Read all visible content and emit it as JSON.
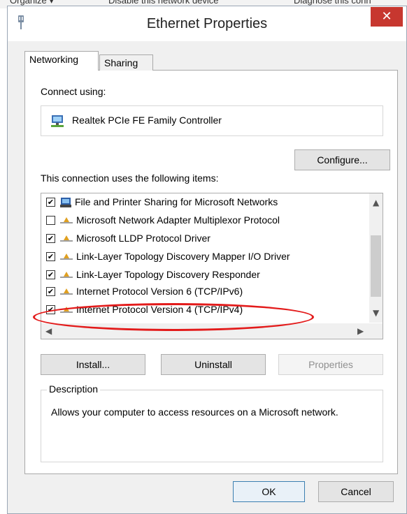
{
  "window": {
    "title": "Ethernet Properties"
  },
  "tabs": [
    "Networking",
    "Sharing"
  ],
  "connect_using_label": "Connect using:",
  "adapter_name": "Realtek PCIe FE Family Controller",
  "configure_button": "Configure...",
  "items_label": "This connection uses the following items:",
  "items": [
    {
      "label": "File and Printer Sharing for Microsoft Networks",
      "checked": true,
      "icon": "printer-share-icon"
    },
    {
      "label": "Microsoft Network Adapter Multiplexor Protocol",
      "checked": false,
      "icon": "network-protocol-icon"
    },
    {
      "label": "Microsoft LLDP Protocol Driver",
      "checked": true,
      "icon": "network-protocol-icon"
    },
    {
      "label": "Link-Layer Topology Discovery Mapper I/O Driver",
      "checked": true,
      "icon": "network-protocol-icon"
    },
    {
      "label": "Link-Layer Topology Discovery Responder",
      "checked": true,
      "icon": "network-protocol-icon"
    },
    {
      "label": "Internet Protocol Version 6 (TCP/IPv6)",
      "checked": true,
      "icon": "network-protocol-icon"
    },
    {
      "label": "Internet Protocol Version 4 (TCP/IPv4)",
      "checked": true,
      "icon": "network-protocol-icon",
      "highlighted": true
    }
  ],
  "buttons": {
    "install": "Install...",
    "uninstall": "Uninstall",
    "properties": "Properties",
    "ok": "OK",
    "cancel": "Cancel"
  },
  "description": {
    "legend": "Description",
    "text": "Allows your computer to access resources on a Microsoft network."
  },
  "background_toolbar": [
    "Organize ▾",
    "Disable this network device",
    "Diagnose this conn"
  ],
  "colors": {
    "close": "#c7372f",
    "annotation": "#e31b1b",
    "dialog_bg": "#f0f0f0"
  }
}
